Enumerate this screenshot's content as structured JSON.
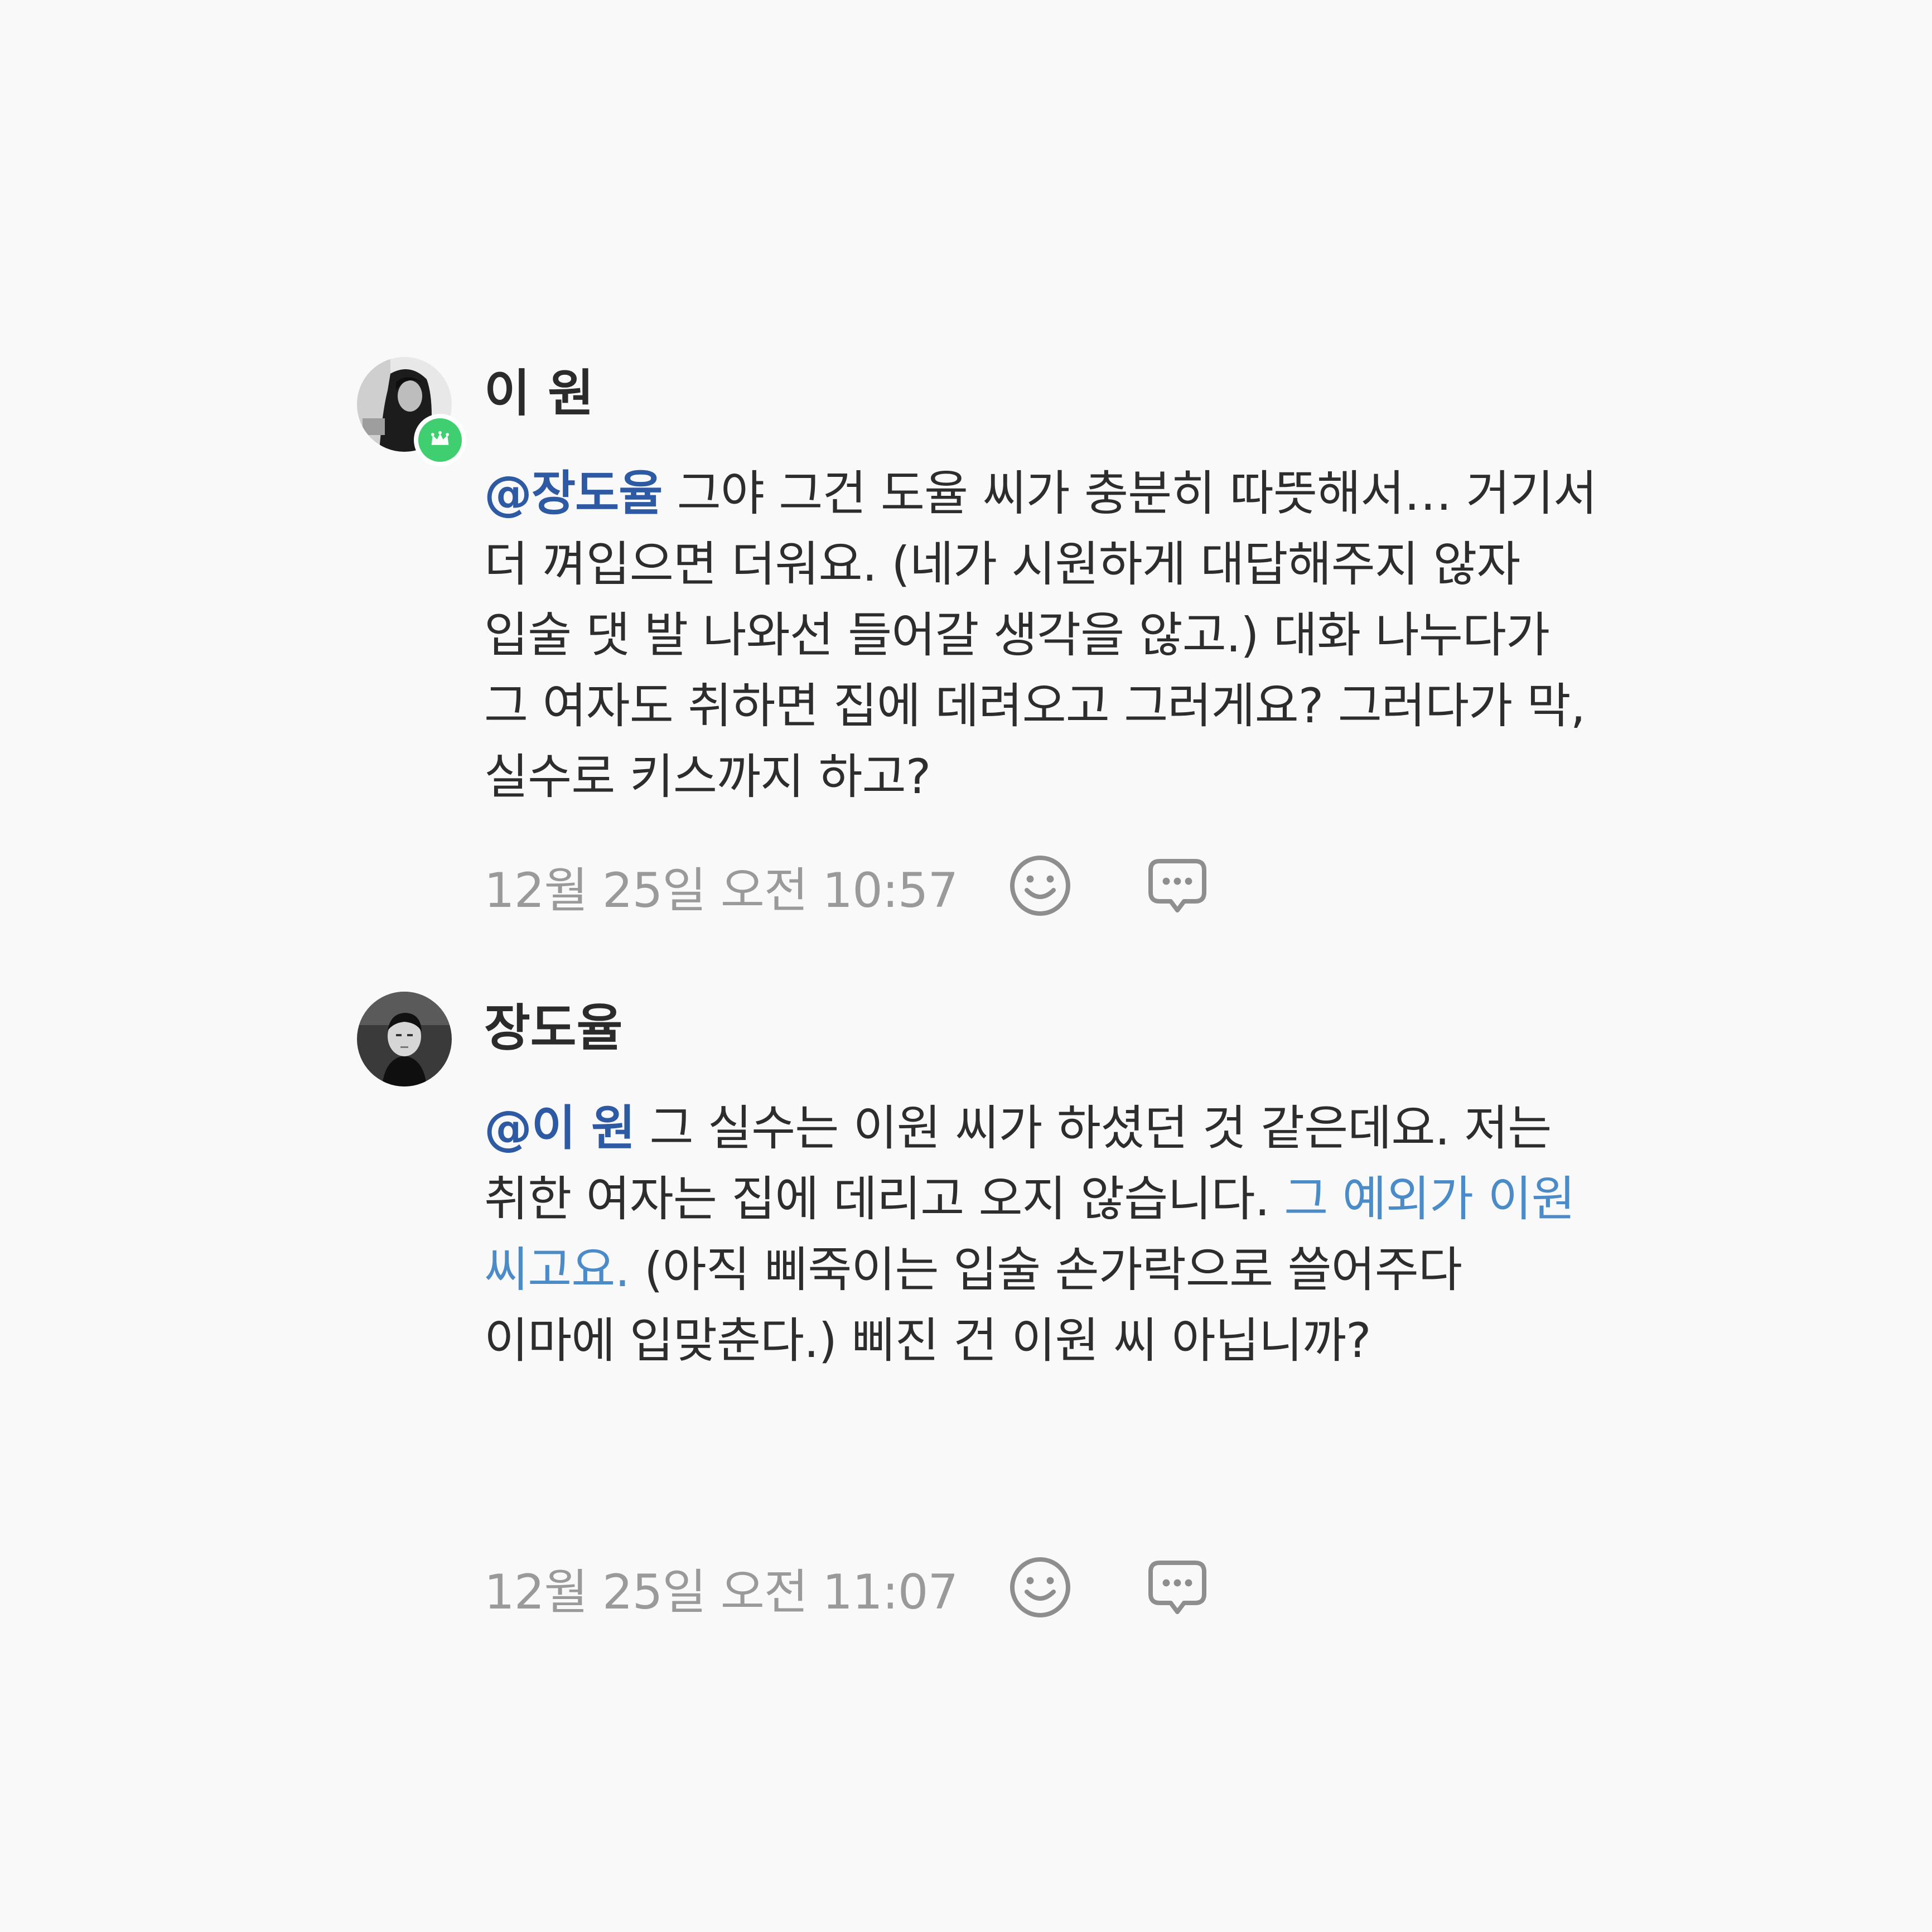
{
  "comments": [
    {
      "author": "이 원",
      "avatar_icon": "profile-photo-woman",
      "badge_icon": "crown-icon",
      "mention": "@장도율",
      "text_parts": [
        " 그야 그건 도율 씨가 충분히 따뜻해서… 거기서 더 껴입으면 더워요. (네가 시원하게 대답해주지 않자 입술 댓 발 나와선 들어갈 생각을 않고.) 대화 나누다가 그 여자도 취하면 집에 데려오고 그러게요? 그러다가 막, 실수로 키스까지 하고?"
      ],
      "timestamp": "12월 25일 오전 10:57",
      "reaction_icon": "smiley-icon",
      "reply_icon": "speech-bubble-icon"
    },
    {
      "author": "장도율",
      "avatar_icon": "profile-photo-man",
      "mention": "@이 원",
      "text_before_link": " 그 실수는 이원 씨가 하셨던 것 같은데요. 저는 취한 여자는 집에 데리고 오지 않습니다. ",
      "link_text": "그 예외가 이원 씨고요.",
      "text_after_link": " (아직 삐죽이는 입술 손가락으로 쓸어주다 이마에 입맞춘다.) 삐진 건 이원 씨 아닙니까?",
      "timestamp": "12월 25일 오전 11:07",
      "reaction_icon": "smiley-icon",
      "reply_icon": "speech-bubble-icon"
    }
  ],
  "colors": {
    "background": "#f9f9f9",
    "mention": "#2d5aa3",
    "link": "#4b8bc8",
    "text": "#2d2d2d",
    "timestamp": "#9a9a9a",
    "badge": "#3fcf70"
  }
}
